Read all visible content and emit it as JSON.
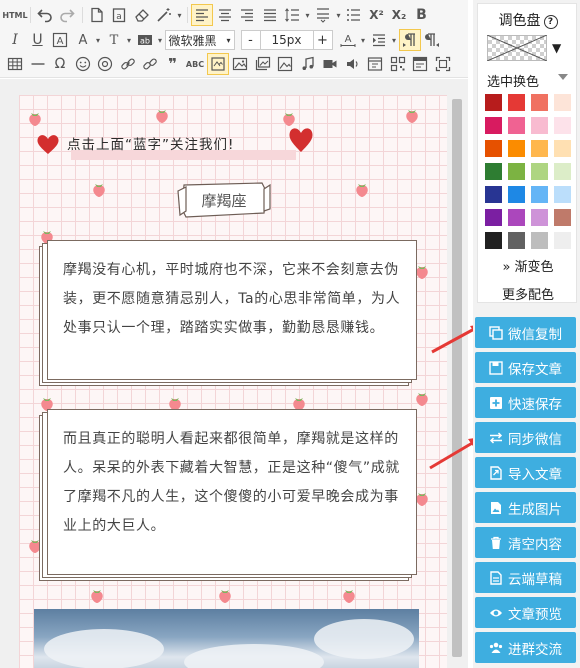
{
  "toolbar": {
    "html_label": "HTML",
    "font_family": "微软雅黑",
    "font_size": "15px",
    "minus": "-",
    "plus": "+",
    "superscript": "X²",
    "subscript": "X₂",
    "bold": "B",
    "italic": "I",
    "underline": "U",
    "spellcheck": "ABC",
    "quote": "❞"
  },
  "article": {
    "follow_text": "点击上面“蓝字”关注我们!",
    "tag_title": "摩羯座",
    "para1": "摩羯没有心机，平时城府也不深，它来不会刻意去伪装，更不愿随意猜忌别人，Ta的心思非常简单，为人处事只认一个理，踏踏实实做事，勤勤恳恳赚钱。",
    "para2": "而且真正的聪明人看起来都很简单，摩羯就是这样的人。呆呆的外表下藏着大智慧，正是这种“傻气”成就了摩羯不凡的人生，这个傻傻的小可爱早晚会成为事业上的大巨人。"
  },
  "palette": {
    "title": "调色盘",
    "help": "?",
    "select_swap": "选中换色",
    "gradient": "渐变色",
    "gradient_prefix": "»",
    "more": "更多配色",
    "swatches": [
      "#b71c1c",
      "#e53935",
      "#f07161",
      "#fde4d8",
      "#d81b60",
      "#f06292",
      "#f8bbd0",
      "#fde2ea",
      "#e65100",
      "#fb8c00",
      "#ffb74d",
      "#ffe0b2",
      "#2e7d32",
      "#7cb342",
      "#aed581",
      "#dcedc8",
      "#283593",
      "#1e88e5",
      "#64b5f6",
      "#bbdefb",
      "#7b1fa2",
      "#ab47bc",
      "#ce93d8",
      "#bf7a6a",
      "#212121",
      "#616161",
      "#bdbdbd",
      "#eeeeee"
    ]
  },
  "actions": [
    {
      "label": "微信复制",
      "icon": "copy-icon"
    },
    {
      "label": "保存文章",
      "icon": "save-icon"
    },
    {
      "label": "快速保存",
      "icon": "plus-box-icon"
    },
    {
      "label": "同步微信",
      "icon": "sync-icon"
    },
    {
      "label": "导入文章",
      "icon": "import-icon"
    },
    {
      "label": "生成图片",
      "icon": "image-icon"
    },
    {
      "label": "清空内容",
      "icon": "trash-icon"
    },
    {
      "label": "云端草稿",
      "icon": "cloud-draft-icon"
    },
    {
      "label": "文章预览",
      "icon": "eye-icon"
    },
    {
      "label": "进群交流",
      "icon": "group-icon"
    }
  ],
  "colors": {
    "action_bg": "#3eaee0",
    "annotation_arrow": "#e53935",
    "heart": "#d32f2f",
    "strawberry": "#f4898f"
  }
}
